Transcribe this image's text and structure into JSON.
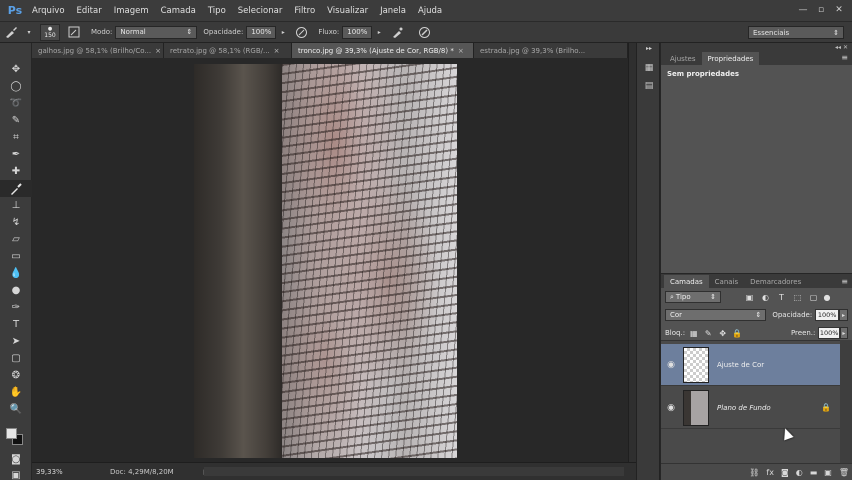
{
  "app": {
    "logo": "Ps"
  },
  "menu": [
    "Arquivo",
    "Editar",
    "Imagem",
    "Camada",
    "Tipo",
    "Selecionar",
    "Filtro",
    "Visualizar",
    "Janela",
    "Ajuda"
  ],
  "window_controls": {
    "minimize": "—",
    "maximize": "▫",
    "close": "✕"
  },
  "options": {
    "brush_size": "150",
    "mode_label": "Modo:",
    "mode_value": "Normal",
    "opacity_label": "Opacidade:",
    "opacity_value": "100%",
    "flow_label": "Fluxo:",
    "flow_value": "100%",
    "workspace": "Essenciais"
  },
  "tabs": [
    {
      "label": "galhos.jpg @ 58,1% (Brilho/Co...",
      "active": false
    },
    {
      "label": "retrato.jpg @ 58,1% (RGB/...",
      "active": false
    },
    {
      "label": "tronco.jpg @ 39,3% (Ajuste de Cor, RGB/8) *",
      "active": true
    },
    {
      "label": "estrada.jpg @ 39,3% (Brilho...",
      "active": false
    }
  ],
  "tab_close": "×",
  "status": {
    "zoom": "39,33%",
    "doc_info": "Doc: 4,29M/8,20M",
    "arrow": "▶"
  },
  "properties": {
    "tabs": [
      "Ajustes",
      "Propriedades"
    ],
    "active_tab": 1,
    "empty_text": "Sem propriedades",
    "menu_icon": "≡",
    "collapse_icon": "◂◂ ✕"
  },
  "layers": {
    "tabs": [
      "Camadas",
      "Canais",
      "Demarcadores"
    ],
    "filter_value": "Tipo",
    "blend_value": "Cor",
    "opacity_label": "Opacidade:",
    "opacity_value": "100%",
    "lock_label": "Bloq.:",
    "fill_label": "Preen.:",
    "fill_value": "100%",
    "items": [
      {
        "name": "Ajuste de Cor",
        "selected": true,
        "locked": false
      },
      {
        "name": "Plano de Fundo",
        "selected": false,
        "locked": true
      }
    ],
    "menu_icon": "≡"
  },
  "colors": {
    "accent_selected_layer": "#6d7f9d",
    "ps_logo": "#5aa0e6"
  }
}
